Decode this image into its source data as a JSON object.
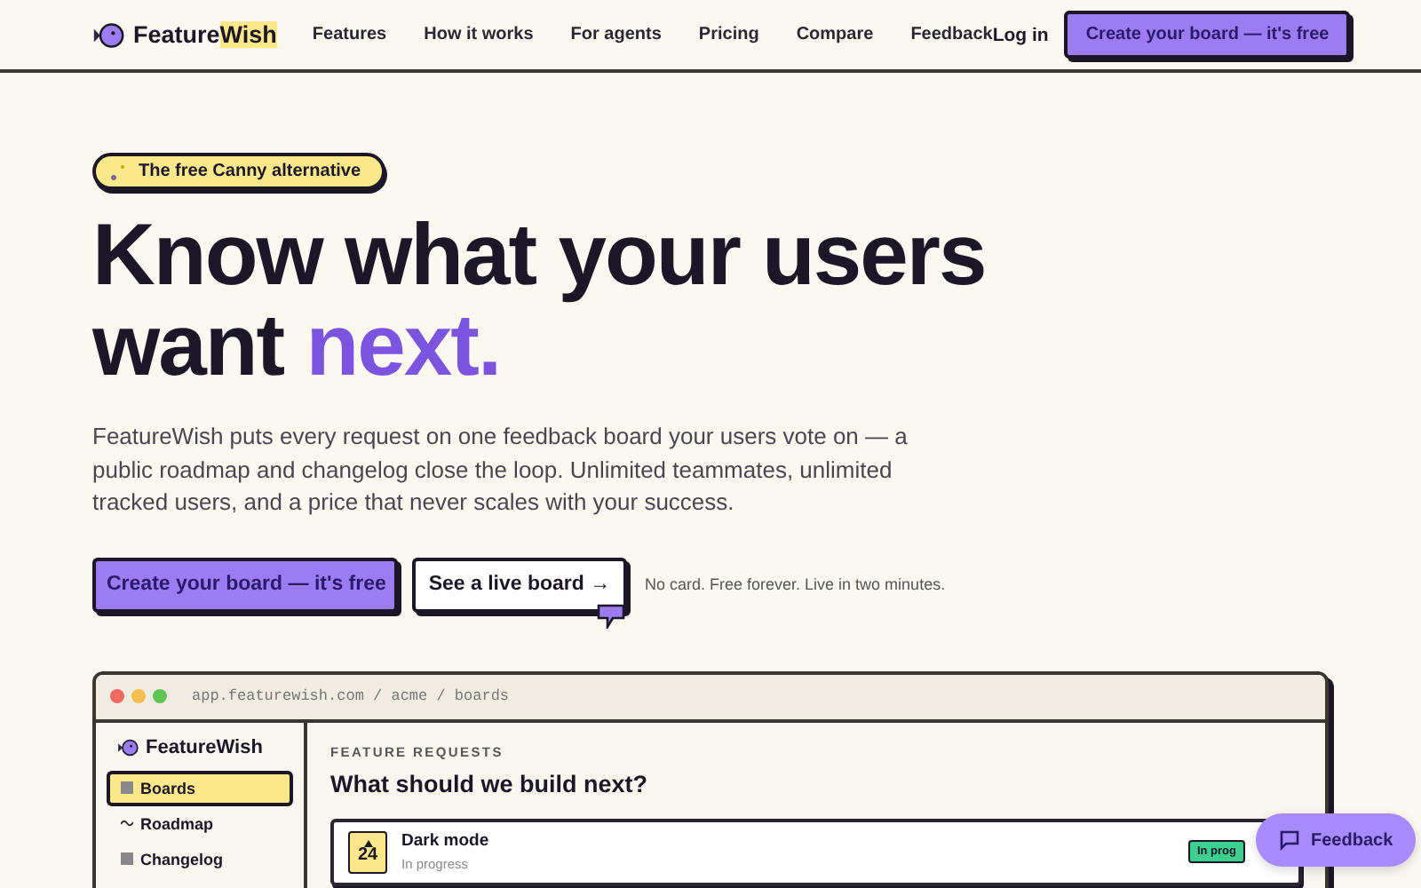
{
  "brand": {
    "name": "Feature",
    "highlight": "Wish"
  },
  "nav": {
    "links": [
      "Features",
      "How it works",
      "For agents",
      "Pricing",
      "Compare",
      "Feedback"
    ],
    "login": "Log in",
    "cta": "Create your board — it's free"
  },
  "hero": {
    "badge": "The free Canny alternative",
    "headline": "Know what your users",
    "headline_2": "want",
    "headline_accent": "next.",
    "body": "FeatureWish puts every request on one feedback board your users vote on — a public roadmap and changelog close the loop. Unlimited teammates, unlimited tracked users, and a price that never scales with your success.",
    "primary": "Create your board — it's free",
    "secondary": "See a live board →",
    "note": "No card. Free forever. Live in two minutes."
  },
  "app_window": {
    "url": "app.featurewish.com / acme / boards",
    "sidebar": {
      "brand": "FeatureWish",
      "items": [
        {
          "label": "Boards",
          "kind": "grid",
          "selected": true
        },
        {
          "label": "Roadmap",
          "kind": "wave",
          "selected": false
        },
        {
          "label": "Changelog",
          "kind": "grid",
          "selected": false
        }
      ]
    },
    "eyebrow": "FEATURE REQUESTS",
    "title": "What should we build next?",
    "requests": [
      {
        "title": "Dark mode",
        "status": "In progress",
        "votes": "24",
        "tag": "In prog"
      }
    ]
  },
  "feedback_button": "Feedback"
}
